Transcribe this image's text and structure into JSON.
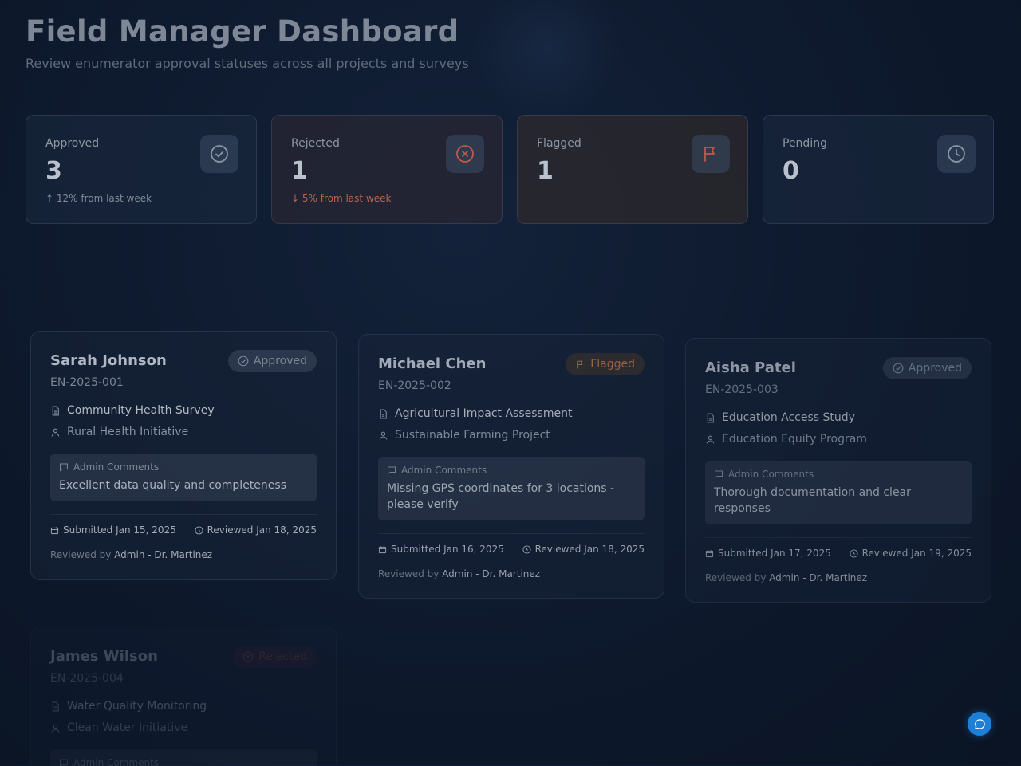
{
  "header": {
    "title": "Field Manager Dashboard",
    "subtitle": "Review enumerator approval statuses across all projects and surveys"
  },
  "stats": [
    {
      "label": "Approved",
      "value": "3",
      "trend": "↑ 12% from last week",
      "icon": "check-circle-icon",
      "color": "#8a96a6"
    },
    {
      "label": "Rejected",
      "value": "1",
      "trend": "↓ 5% from last week",
      "icon": "x-circle-icon",
      "color": "#c0584a"
    },
    {
      "label": "Flagged",
      "value": "1",
      "trend": "",
      "icon": "flag-icon",
      "color": "#c0584a"
    },
    {
      "label": "Pending",
      "value": "0",
      "trend": "",
      "icon": "clock-icon",
      "color": "#8a96a6"
    }
  ],
  "comments_label": "Admin Comments",
  "reviewed_by_prefix": "Reviewed by",
  "cards": [
    {
      "name": "Sarah Johnson",
      "id": "EN-2025-001",
      "status": "Approved",
      "survey": "Community Health Survey",
      "project": "Rural Health Initiative",
      "comment": "Excellent data quality and completeness",
      "submitted": "Submitted Jan 15, 2025",
      "reviewed": "Reviewed Jan 18, 2025",
      "reviewer": "Admin - Dr. Martinez"
    },
    {
      "name": "Michael Chen",
      "id": "EN-2025-002",
      "status": "Flagged",
      "survey": "Agricultural Impact Assessment",
      "project": "Sustainable Farming Project",
      "comment": "Missing GPS coordinates for 3 locations - please verify",
      "submitted": "Submitted Jan 16, 2025",
      "reviewed": "Reviewed Jan 18, 2025",
      "reviewer": "Admin - Dr. Martinez"
    },
    {
      "name": "Aisha Patel",
      "id": "EN-2025-003",
      "status": "Approved",
      "survey": "Education Access Study",
      "project": "Education Equity Program",
      "comment": "Thorough documentation and clear responses",
      "submitted": "Submitted Jan 17, 2025",
      "reviewed": "Reviewed Jan 19, 2025",
      "reviewer": "Admin - Dr. Martinez"
    },
    {
      "name": "James Wilson",
      "id": "EN-2025-004",
      "status": "Rejected",
      "survey": "Water Quality Monitoring",
      "project": "Clean Water Initiative"
    }
  ],
  "colors": {
    "accent": "#1e7fd6",
    "rejected": "#c0584a",
    "background": "#0e1a2e"
  }
}
